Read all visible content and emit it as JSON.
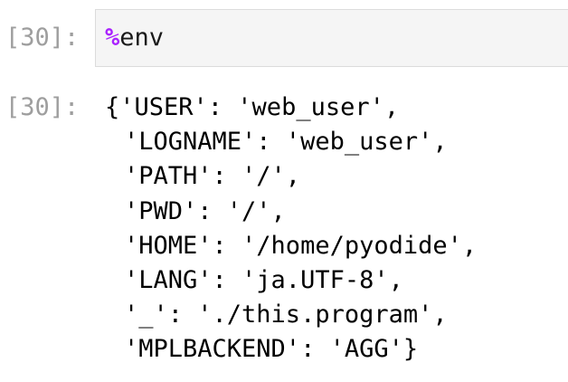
{
  "input_cell": {
    "prompt": "[30]:",
    "magic_symbol": "%",
    "command": "env"
  },
  "output_cell": {
    "prompt": "[30]:",
    "lines": [
      "{'USER': 'web_user',",
      "'LOGNAME': 'web_user',",
      "'PATH': '/',",
      "'PWD': '/',",
      "'HOME': '/home/pyodide',",
      "'LANG': 'ja.UTF-8',",
      "'_': './this.program',",
      "'MPLBACKEND': 'AGG'}"
    ]
  },
  "colors": {
    "prompt": "#9e9e9e",
    "magic": "#aa22ff",
    "input_background": "#f5f5f5",
    "input_border": "#dcdcdc"
  }
}
